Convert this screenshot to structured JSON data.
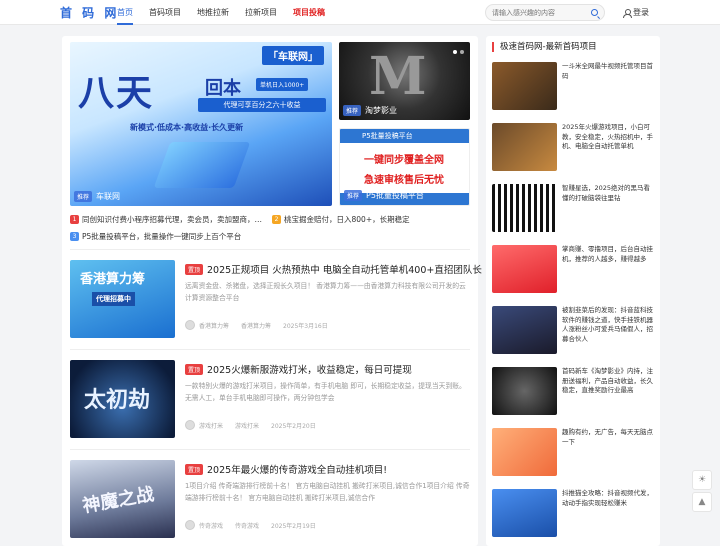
{
  "header": {
    "logo": "首 码 网",
    "nav": [
      "首页",
      "首码项目",
      "地推拉新",
      "拉新项目",
      "项目投稿"
    ],
    "search_placeholder": "请输入感兴趣的内容",
    "login": "登录"
  },
  "slider": {
    "main": {
      "brand": "「车联网」",
      "big": "八天",
      "ret": "回本",
      "pill": "单机日入1000+",
      "band": "代理可享百分之六十收益",
      "sub": "新模式·低成本·高收益·长久更新",
      "tag": "推荐",
      "caption": "车联网"
    },
    "side1": {
      "tag": "推荐",
      "caption": "淘梦影业",
      "logo_text": "M"
    },
    "side2": {
      "top": "P5批量投稿平台",
      "l1": "一键同步覆盖全网",
      "l2": "急速审核售后无忧",
      "tag": "推荐",
      "caption": "P5批量投稿平台"
    }
  },
  "headlines": [
    {
      "num": "1",
      "text": "同创知识付费小程序招募代理，卖会员，卖加盟商，…"
    },
    {
      "num": "2",
      "text": "桃宝掘金赔付，日入800+，长期稳定"
    },
    {
      "num": "3",
      "text": "P5批量投稿平台，批量操作一键同步上百个平台"
    }
  ],
  "posts": [
    {
      "badge": "置顶",
      "title": "2025正规项目 火热预热中 电脑全自动托管单机400+直招团队长",
      "excerpt": "远离资金盘、杀猪盘，选择正规长久项目！ 香港算力筹——由香港算力科技有限公司开发的云计算资源整合平台",
      "author": "香港算力筹",
      "cat": "香港算力筹",
      "date": "2025年3月16日",
      "thumb_text": "香港算力筹",
      "thumb_sub": "代理招募中"
    },
    {
      "badge": "置顶",
      "title": "2025火爆新服游戏打米，收益稳定，每日可提现",
      "excerpt": "一款特别火爆的游戏打米项目，操作简单，有手机电脑 即可，长期稳定收益，提现当天到账。无需人工，单台手机电脑即可操作，两分钟包学会",
      "author": "游戏打米",
      "cat": "游戏打米",
      "date": "2025年2月20日",
      "thumb_text": "太初劫"
    },
    {
      "badge": "置顶",
      "title": "2025年最火爆的传奇游戏全自动挂机项目!",
      "excerpt": "1项目介绍 传奇端游排行榜前十名！ 官方电脑自动挂机 搬砖打米项目,诚信合作1项目介绍 传奇端游排行榜前十名！ 官方电脑自动挂机 搬砖打米项目,诚信合作",
      "author": "传奇游戏",
      "cat": "传奇游戏",
      "date": "2025年2月19日",
      "thumb_text": "神魔之战"
    }
  ],
  "sidebar": {
    "title": "极速首码网-最新首码项目",
    "items": [
      "一斗米全网最牛视频托管项目首码",
      "2025年火爆游戏项目，小白可教，安全稳定，火热招机中，手机、电脑全自动托管单机",
      "智赚星选，2025绝对的黑马看懂的打破脑袋往里钻",
      "掌商赚、零撸项目，后台自动挂机，推荐的人越多，赚得越多",
      "被割韭菜后的发现：抖音蓝科技软件的赚钱之道，快手挂铁机器人涨粉丝小可爱兵马俑假人，招募合伙人",
      "首码新车《淘梦影业》内持，注册送福利，产品自动收益，长久稳定，直推奖励行业最高",
      "趣购有约，无广告，每天无脑点一下",
      "抖推猫全攻略：抖音视频代发，动动手指实现轻松赚米"
    ]
  }
}
